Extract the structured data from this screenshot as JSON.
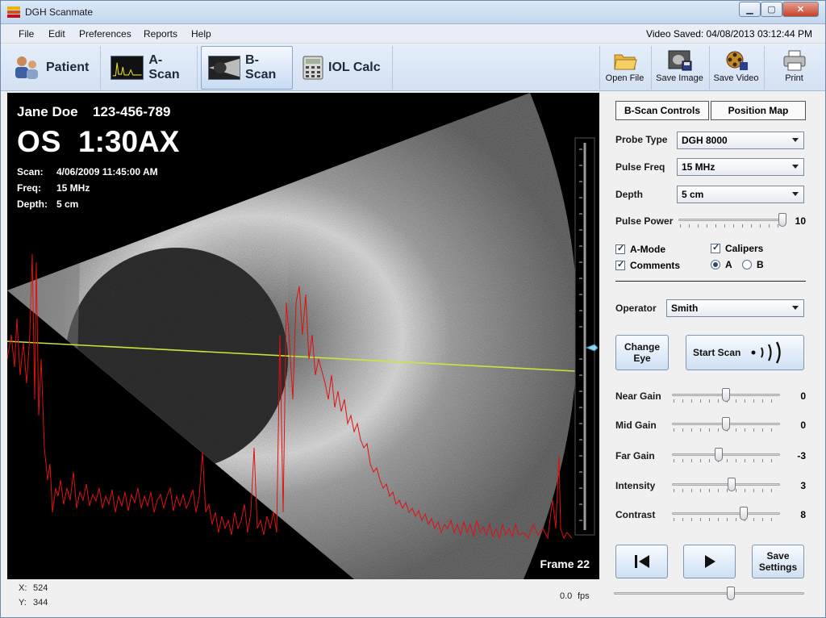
{
  "window": {
    "title": "DGH Scanmate"
  },
  "menu": [
    "File",
    "Edit",
    "Preferences",
    "Reports",
    "Help"
  ],
  "video_saved": "Video Saved:  04/08/2013  03:12:44  PM",
  "toolbar": {
    "tabs": [
      "Patient",
      "A-Scan",
      "B-Scan",
      "IOL Calc"
    ],
    "active_tab": "B-Scan",
    "buttons": [
      "Open File",
      "Save Image",
      "Save Video",
      "Print"
    ]
  },
  "scan": {
    "patient_name": "Jane Doe",
    "patient_id": "123-456-789",
    "eye": "OS",
    "axis": "1:30AX",
    "scan_label": "Scan:",
    "scan_value": "4/06/2009 11:45:00 AM",
    "freq_label": "Freq:",
    "freq_value": "15 MHz",
    "depth_label": "Depth:",
    "depth_value": "5 cm",
    "frame": "Frame 22"
  },
  "status": {
    "x_label": "X:",
    "x_value": "524",
    "y_label": "Y:",
    "y_value": "344",
    "fps_value": "0.0",
    "fps_unit": "fps"
  },
  "panel": {
    "tabs": [
      "B-Scan Controls",
      "Position Map"
    ],
    "probe_type": {
      "label": "Probe Type",
      "value": "DGH 8000"
    },
    "pulse_freq": {
      "label": "Pulse Freq",
      "value": "15 MHz"
    },
    "depth": {
      "label": "Depth",
      "value": "5 cm"
    },
    "pulse_power": {
      "label": "Pulse Power",
      "value": "10",
      "level": 1.0
    },
    "checks": {
      "amode": "A-Mode",
      "comments": "Comments",
      "calipers": "Calipers"
    },
    "radio": {
      "a": "A",
      "b": "B",
      "selected": "A"
    },
    "operator": {
      "label": "Operator",
      "value": "Smith"
    },
    "change_eye": "Change Eye",
    "start_scan": "Start Scan",
    "gains": [
      {
        "label": "Near Gain",
        "value": "0",
        "level": 0.5
      },
      {
        "label": "Mid Gain",
        "value": "0",
        "level": 0.5
      },
      {
        "label": "Far Gain",
        "value": "-3",
        "level": 0.43
      },
      {
        "label": "Intensity",
        "value": "3",
        "level": 0.56
      },
      {
        "label": "Contrast",
        "value": "8",
        "level": 0.68
      }
    ],
    "save_settings": "Save Settings",
    "playback_level": 0.62
  },
  "colors": {
    "accent": "#c3d7ee",
    "overlay_line": "#c8e63c",
    "amode_trace": "#e01010"
  }
}
